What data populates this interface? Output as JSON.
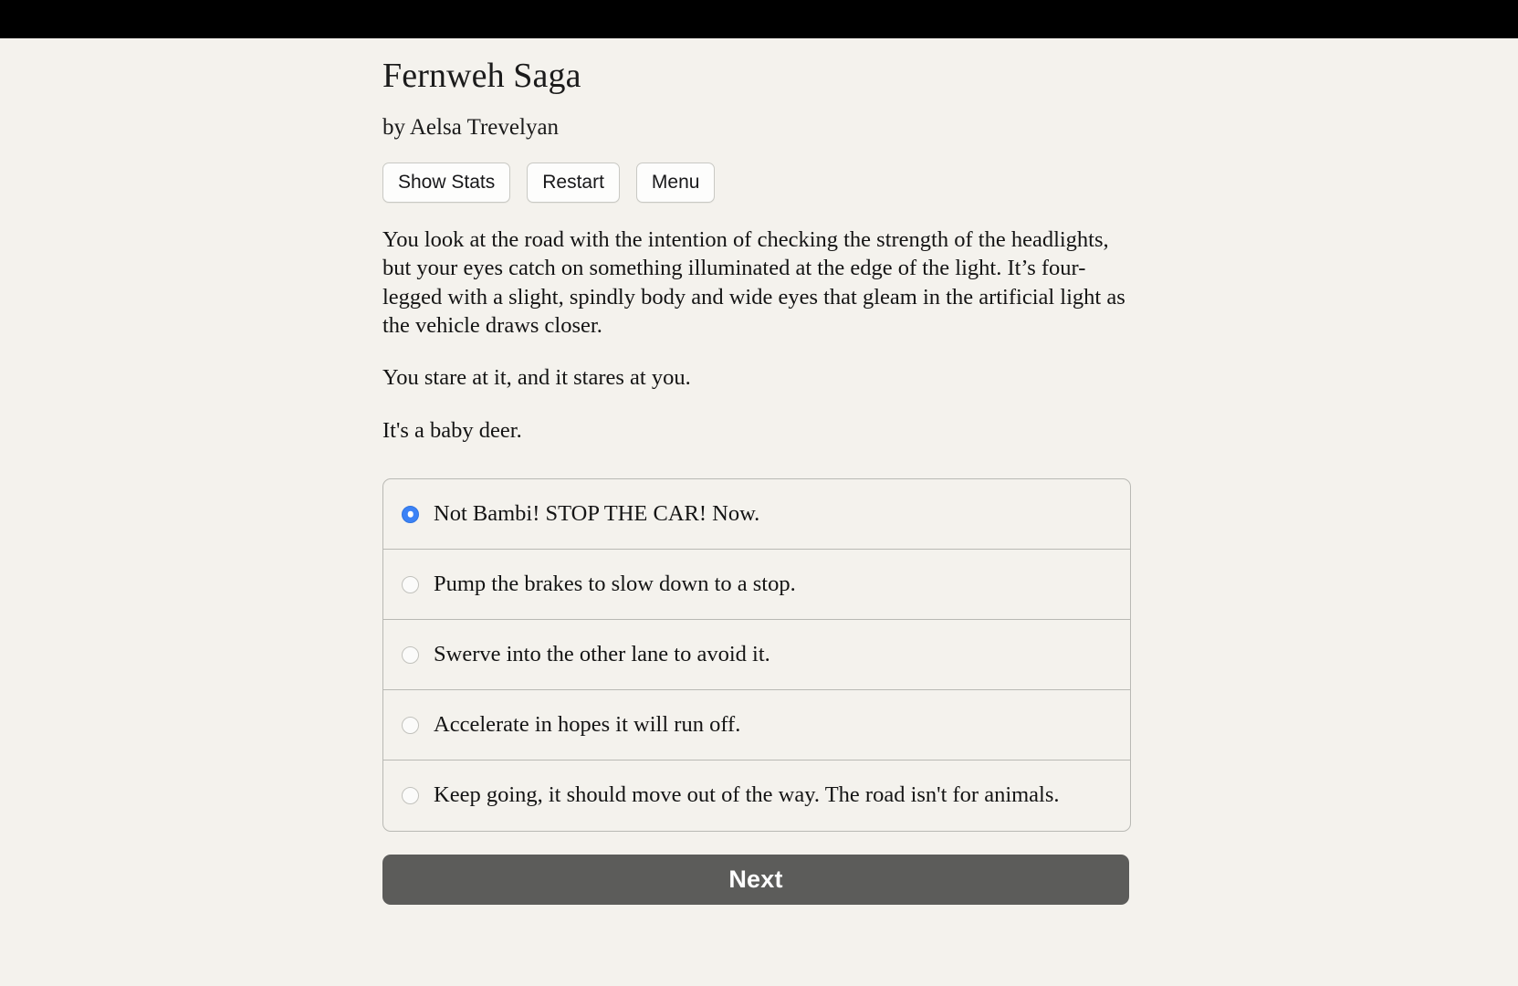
{
  "window": {
    "chrome_bar_color": "#000000",
    "page_background": "#f4f2ed"
  },
  "game": {
    "title": "Fernweh Saga",
    "byline": "by Aelsa Trevelyan"
  },
  "toolbar": {
    "show_stats_label": "Show Stats",
    "restart_label": "Restart",
    "menu_label": "Menu"
  },
  "story": {
    "paragraphs": [
      "You look at the road with the intention of checking the strength of the headlights, but your eyes catch on something illuminated at the edge of the light. It’s four-legged with a slight, spindly body and wide eyes that gleam in the artificial light as the vehicle draws closer.",
      "You stare at it, and it stares at you.",
      "It's a baby deer."
    ]
  },
  "choices": {
    "selected_index": 0,
    "accent_color": "#3b82f6",
    "options": [
      {
        "label": "Not Bambi! STOP THE CAR! Now.",
        "selected": true
      },
      {
        "label": "Pump the brakes to slow down to a stop.",
        "selected": false
      },
      {
        "label": "Swerve into the other lane to avoid it.",
        "selected": false
      },
      {
        "label": "Accelerate in hopes it will run off.",
        "selected": false
      },
      {
        "label": "Keep going, it should move out of the way. The road isn't for animals.",
        "selected": false
      }
    ]
  },
  "actions": {
    "next_label": "Next",
    "next_color": "#5c5c5a"
  }
}
